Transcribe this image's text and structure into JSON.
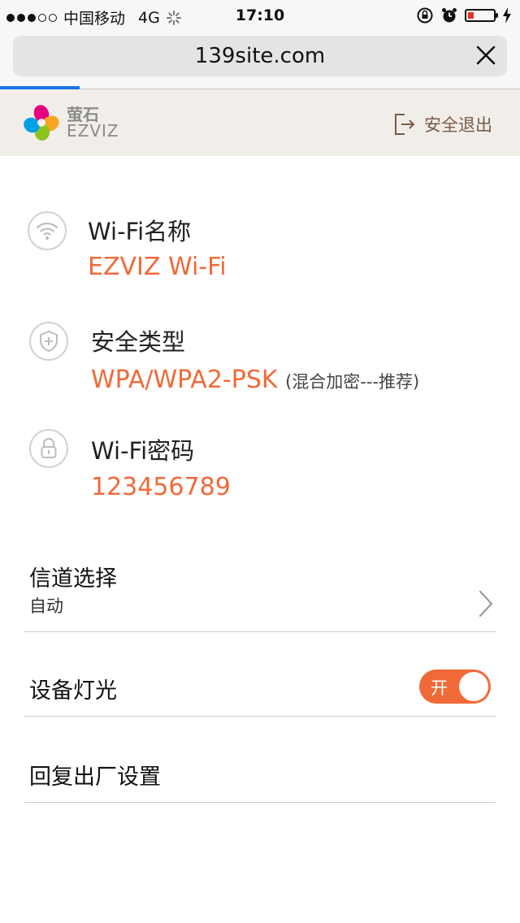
{
  "status_bar": {
    "carrier": "中国移动",
    "network": "4G",
    "time": "17:10"
  },
  "browser": {
    "url": "139site.com"
  },
  "header": {
    "logo_cn": "萤石",
    "logo_en": "EZVIZ",
    "logout_label": "安全退出"
  },
  "wifi_info": {
    "name_label": "Wi-Fi名称",
    "name_value": "EZVIZ Wi-Fi",
    "security_label": "安全类型",
    "security_value": "WPA/WPA2-PSK",
    "security_note": "(混合加密---推荐)",
    "password_label": "Wi-Fi密码",
    "password_value": "123456789"
  },
  "settings": {
    "channel_label": "信道选择",
    "channel_value": "自动",
    "light_label": "设备灯光",
    "light_toggle_label": "开",
    "light_on": true,
    "reset_label": "回复出厂设置"
  },
  "colors": {
    "accent": "#f06a38",
    "header_bg": "#f1eeea",
    "progress": "#1a73e8"
  }
}
